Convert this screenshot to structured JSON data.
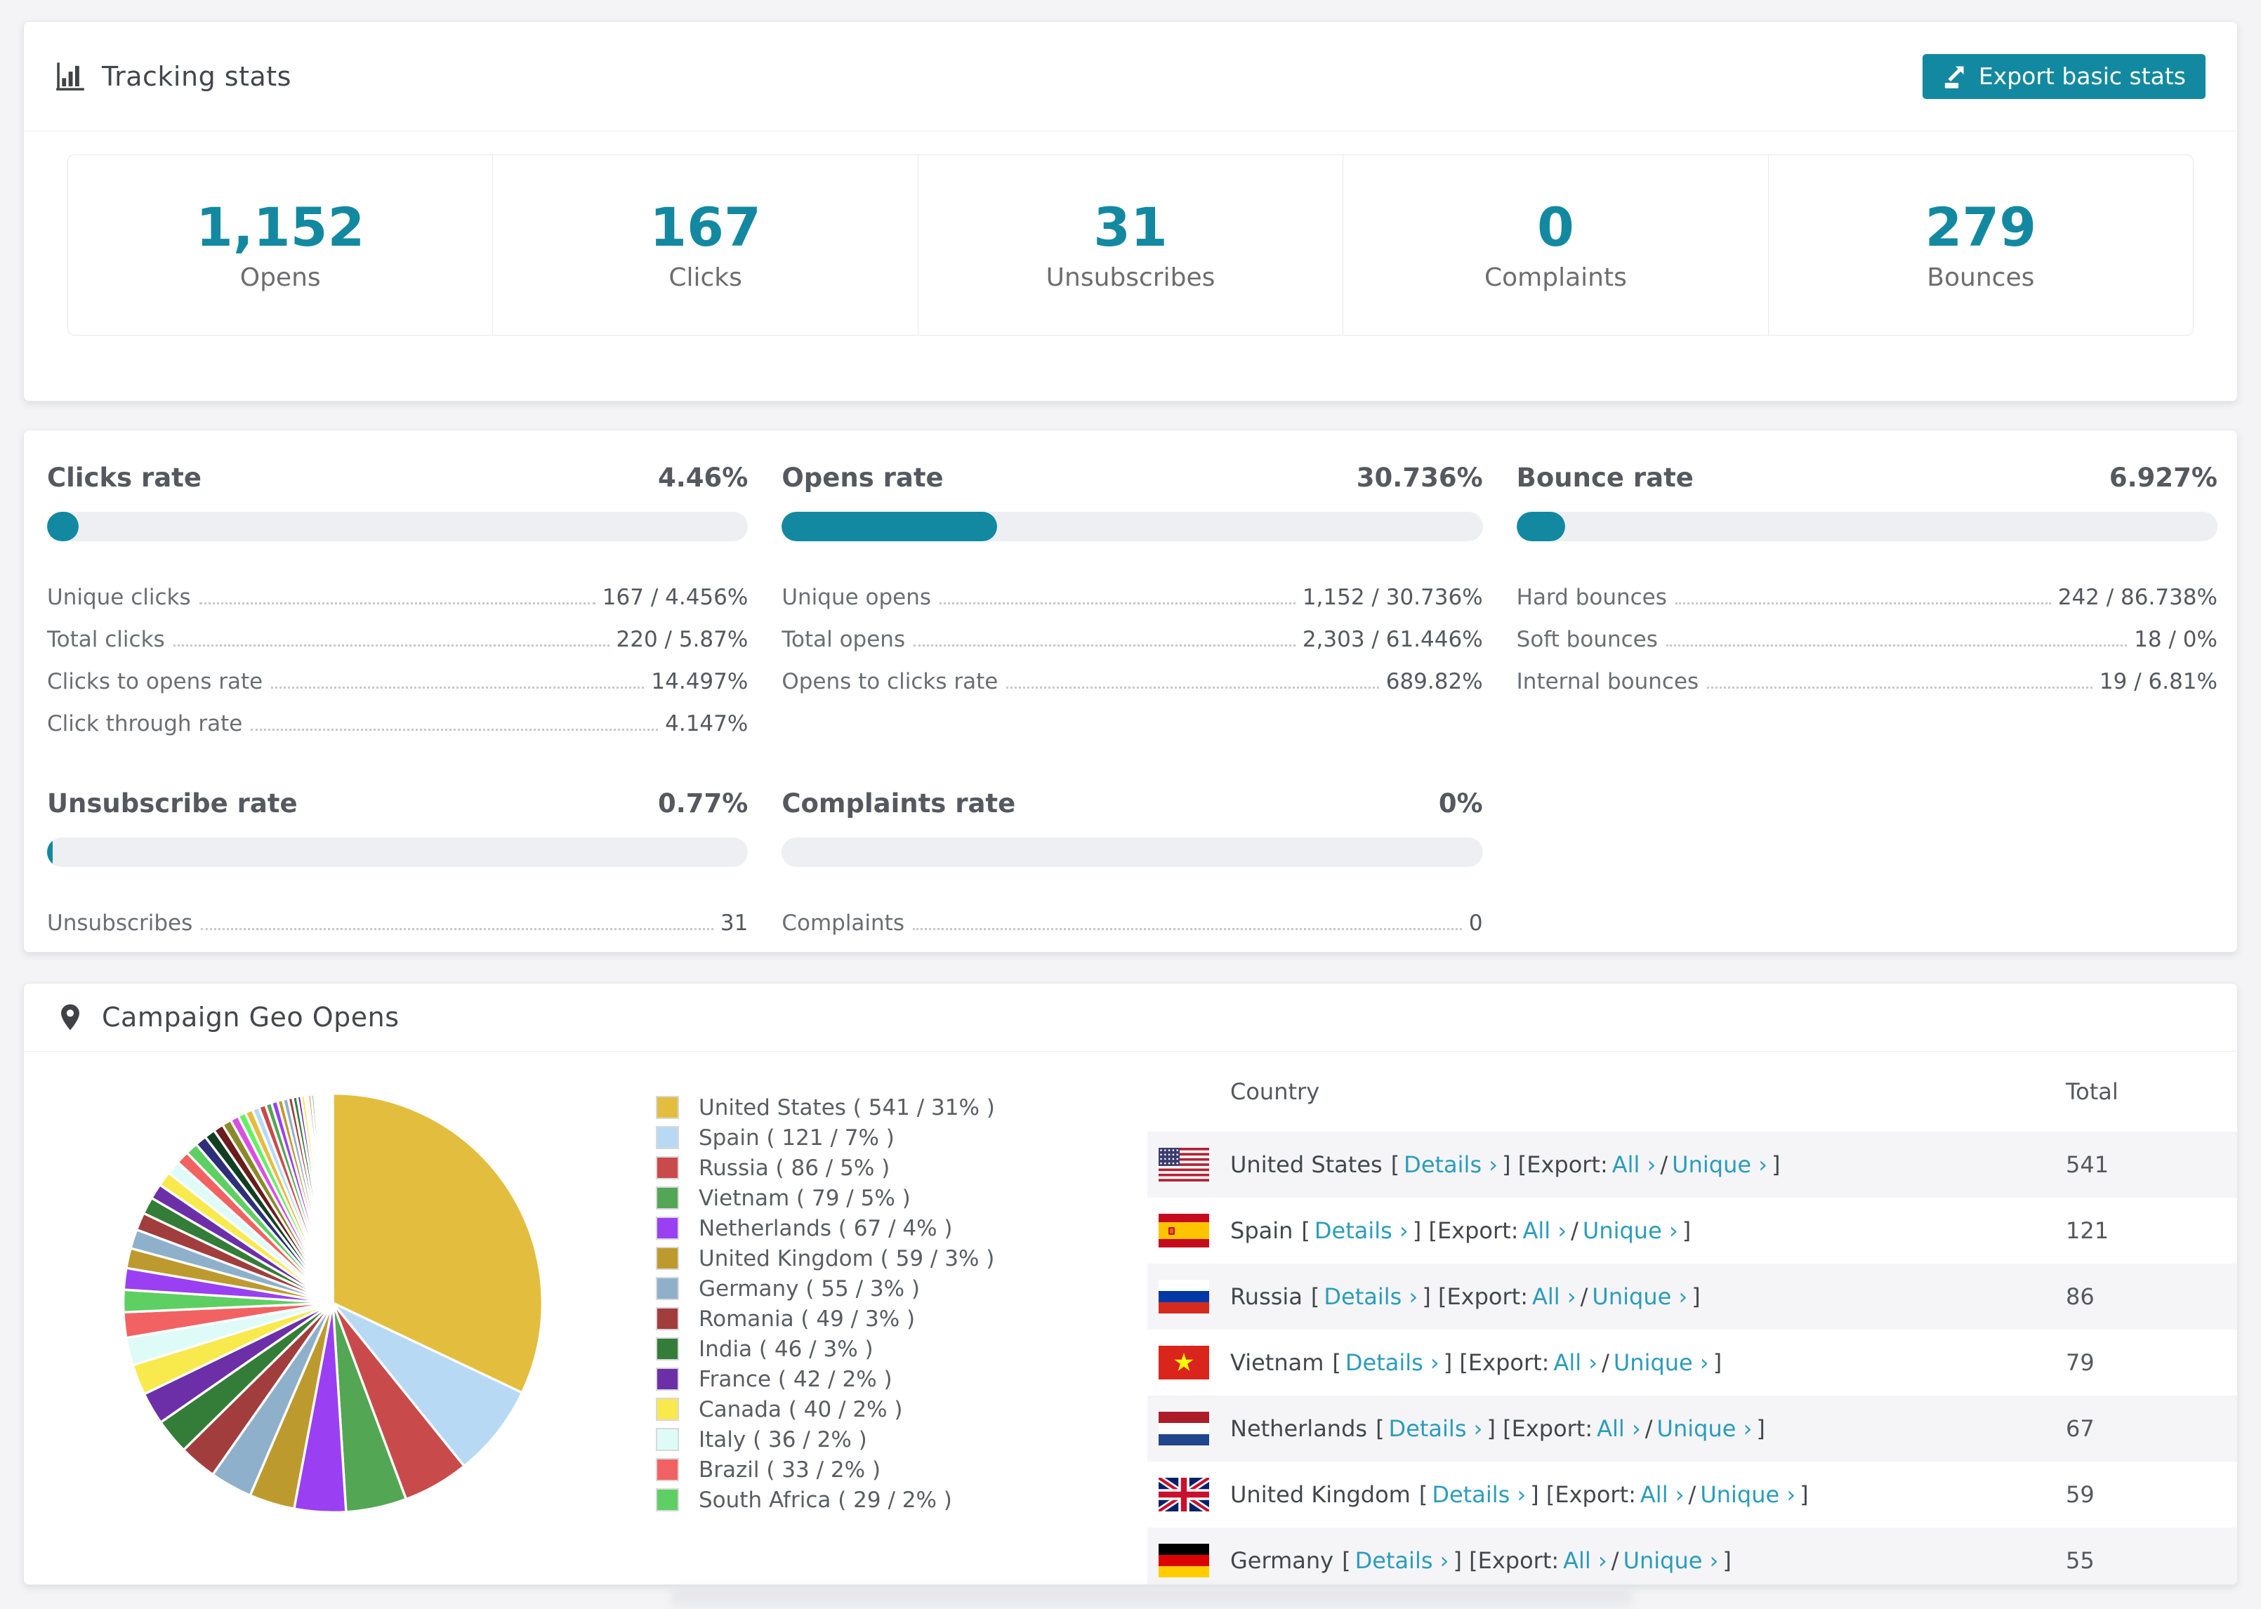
{
  "tracking": {
    "title": "Tracking stats",
    "export_label": "Export basic stats",
    "stats": [
      {
        "value": "1,152",
        "label": "Opens"
      },
      {
        "value": "167",
        "label": "Clicks"
      },
      {
        "value": "31",
        "label": "Unsubscribes"
      },
      {
        "value": "0",
        "label": "Complaints"
      },
      {
        "value": "279",
        "label": "Bounces"
      }
    ]
  },
  "rates": {
    "blocks": [
      {
        "title": "Clicks rate",
        "percent": "4.46%",
        "bar_percent": 4.46,
        "rows": [
          {
            "label": "Unique clicks",
            "value": "167 / 4.456%"
          },
          {
            "label": "Total clicks",
            "value": "220 / 5.87%"
          },
          {
            "label": "Clicks to opens rate",
            "value": "14.497%"
          },
          {
            "label": "Click through rate",
            "value": "4.147%"
          }
        ]
      },
      {
        "title": "Opens rate",
        "percent": "30.736%",
        "bar_percent": 30.736,
        "rows": [
          {
            "label": "Unique opens",
            "value": "1,152 / 30.736%"
          },
          {
            "label": "Total opens",
            "value": "2,303 / 61.446%"
          },
          {
            "label": "Opens to clicks rate",
            "value": "689.82%"
          }
        ]
      },
      {
        "title": "Bounce rate",
        "percent": "6.927%",
        "bar_percent": 6.927,
        "rows": [
          {
            "label": "Hard bounces",
            "value": "242 / 86.738%"
          },
          {
            "label": "Soft bounces",
            "value": "18 / 0%"
          },
          {
            "label": "Internal bounces",
            "value": "19 / 6.81%"
          }
        ]
      },
      {
        "title": "Unsubscribe rate",
        "percent": "0.77%",
        "bar_percent": 0.77,
        "rows": [
          {
            "label": "Unsubscribes",
            "value": "31"
          }
        ]
      },
      {
        "title": "Complaints rate",
        "percent": "0%",
        "bar_percent": 0,
        "rows": [
          {
            "label": "Complaints",
            "value": "0"
          }
        ]
      }
    ]
  },
  "geo": {
    "title": "Campaign Geo Opens",
    "table": {
      "country_header": "Country",
      "total_header": "Total",
      "link_details": "Details ›",
      "link_export_prefix": "[Export:",
      "link_all": "All ›",
      "link_unique": "Unique ›",
      "rows": [
        {
          "country": "United States",
          "total": "541",
          "flag": "us"
        },
        {
          "country": "Spain",
          "total": "121",
          "flag": "es"
        },
        {
          "country": "Russia",
          "total": "86",
          "flag": "ru"
        },
        {
          "country": "Vietnam",
          "total": "79",
          "flag": "vn"
        },
        {
          "country": "Netherlands",
          "total": "67",
          "flag": "nl"
        },
        {
          "country": "United Kingdom",
          "total": "59",
          "flag": "gb"
        },
        {
          "country": "Germany",
          "total": "55",
          "flag": "de"
        }
      ]
    }
  },
  "chart_data": {
    "type": "pie",
    "title": "Campaign Geo Opens",
    "unit": "opens",
    "legend_position": "right",
    "start_angle_deg": -90,
    "direction": "clockwise",
    "slices": [
      {
        "name": "United States",
        "count": 541,
        "pct": 31,
        "color": "#e3bd3d"
      },
      {
        "name": "Spain",
        "count": 121,
        "pct": 7,
        "color": "#b8d9f4"
      },
      {
        "name": "Russia",
        "count": 86,
        "pct": 5,
        "color": "#c94a4a"
      },
      {
        "name": "Vietnam",
        "count": 79,
        "pct": 5,
        "color": "#53a653"
      },
      {
        "name": "Netherlands",
        "count": 67,
        "pct": 4,
        "color": "#9a3ff2"
      },
      {
        "name": "United Kingdom",
        "count": 59,
        "pct": 3,
        "color": "#bd9a2e"
      },
      {
        "name": "Germany",
        "count": 55,
        "pct": 3,
        "color": "#8fb0ca"
      },
      {
        "name": "Romania",
        "count": 49,
        "pct": 3,
        "color": "#a23d3d"
      },
      {
        "name": "India",
        "count": 46,
        "pct": 3,
        "color": "#347d38"
      },
      {
        "name": "France",
        "count": 42,
        "pct": 2,
        "color": "#6d2fa8"
      },
      {
        "name": "Canada",
        "count": 40,
        "pct": 2,
        "color": "#f8e94d"
      },
      {
        "name": "Italy",
        "count": 36,
        "pct": 2,
        "color": "#dffbf8"
      },
      {
        "name": "Brazil",
        "count": 33,
        "pct": 2,
        "color": "#f26262"
      },
      {
        "name": "South Africa",
        "count": 29,
        "pct": 2,
        "color": "#5ecf63"
      }
    ],
    "other_values": [
      28,
      26,
      25,
      23,
      22,
      20,
      19,
      18,
      17,
      16,
      15,
      14,
      13,
      12,
      11,
      10,
      10,
      9,
      9,
      8,
      8,
      7,
      7,
      6,
      6,
      5,
      5,
      4,
      4,
      4,
      3,
      3,
      3,
      2,
      2,
      2,
      2,
      1,
      1,
      1,
      1,
      1,
      1,
      1
    ],
    "extra_colors": [
      "#2e2e7a",
      "#123f23",
      "#6b1c1c",
      "#8a8a2a",
      "#d94fe2",
      "#62f062"
    ],
    "legend_label_format": "{name} ( {count} / {pct}% )"
  },
  "theme": {
    "accent_teal": "#1389a1",
    "link_teal": "#2b9cbd",
    "bar_track": "#edeff3",
    "stripe": "#f5f5f7"
  }
}
